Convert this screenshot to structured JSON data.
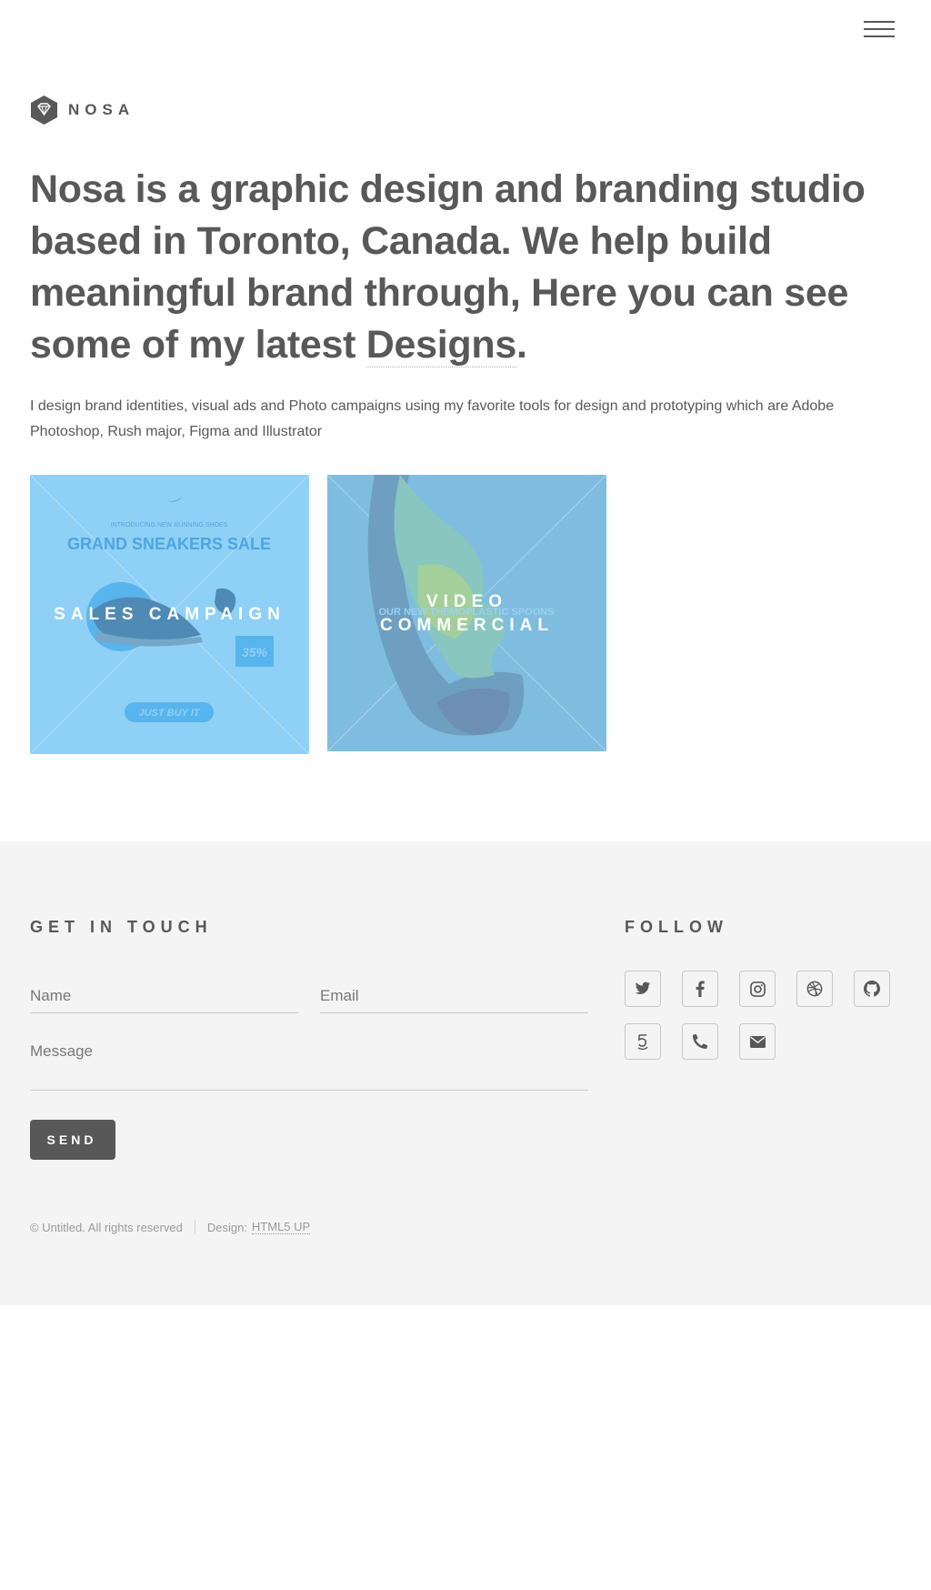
{
  "header": {
    "brand": "NOSA",
    "menu_icon": "hamburger-menu-icon",
    "logo_icon": "diamond-hexagon-logo"
  },
  "intro": {
    "heading_before": "Nosa is a graphic design and branding studio based in Toronto, Canada. We help build meaningful brand through, Here you can see some of my latest ",
    "heading_highlight": "Designs",
    "heading_after": ".",
    "paragraph": "I design brand identities, visual ads and Photo campaigns using my favorite tools for design and prototyping which are Adobe Photoshop, Rush major, Figma and Illustrator"
  },
  "portfolio": [
    {
      "title": "SALES CAMPAIGN",
      "overlay_color": "#8fd0f6",
      "art_text": {
        "tagline": "INTRODUCING NEW RUNNING SHOES",
        "headline": "GRAND SNEAKERS SALE",
        "discount": "35%",
        "cta": "JUST BUY IT"
      }
    },
    {
      "title_line1": "VIDEO",
      "title_line2": "COMMERCIAL",
      "overlay_color": "#7fbde0",
      "art_text": {
        "subtitle": "OUR NEW THEMOPLASTIC SPOONS"
      }
    }
  ],
  "contact": {
    "title": "GET IN TOUCH",
    "name_placeholder": "Name",
    "email_placeholder": "Email",
    "message_placeholder": "Message",
    "send_label": "SEND"
  },
  "follow": {
    "title": "FOLLOW",
    "icons": [
      "twitter-icon",
      "facebook-icon",
      "instagram-icon",
      "dribbble-icon",
      "github-icon",
      "500px-icon",
      "phone-icon",
      "envelope-icon"
    ]
  },
  "footer": {
    "copyright": "© Untitled. All rights reserved",
    "design_label": "Design:",
    "design_link": "HTML5 UP"
  },
  "colors": {
    "text": "#585858",
    "footer_bg": "#f4f4f4",
    "button_bg": "#585858"
  }
}
